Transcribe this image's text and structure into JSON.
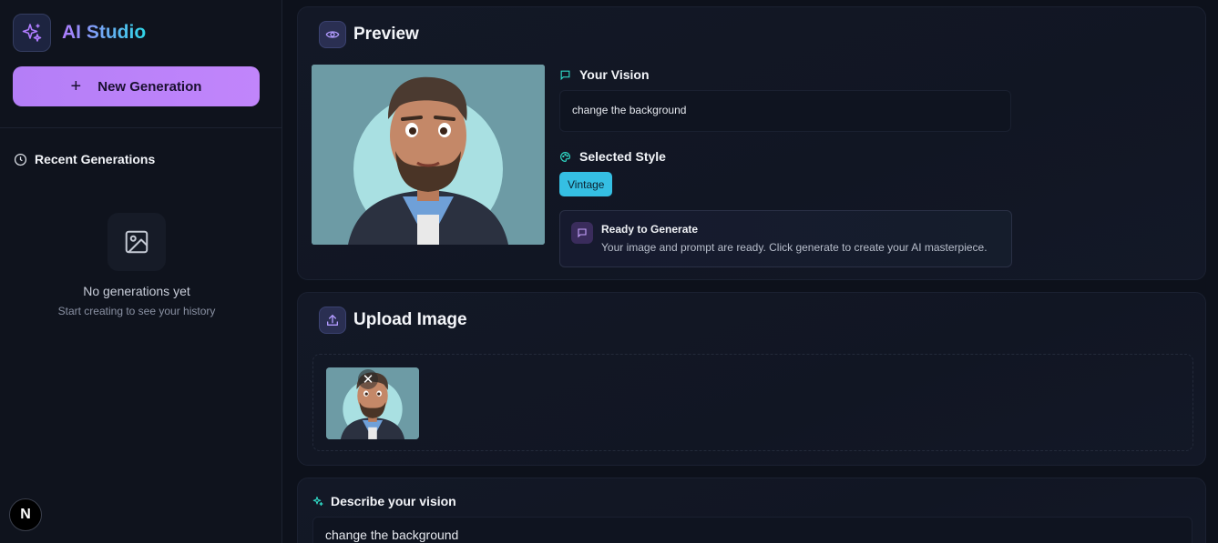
{
  "sidebar": {
    "brand_title": "AI Studio",
    "new_generation_label": "New Generation",
    "recent_title": "Recent Generations",
    "empty_title": "No generations yet",
    "empty_subtitle": "Start creating to see your history",
    "badge_letter": "N"
  },
  "preview": {
    "title": "Preview",
    "vision_label": "Your Vision",
    "vision_text": "change the background",
    "style_label": "Selected Style",
    "style_value": "Vintage",
    "ready_title": "Ready to Generate",
    "ready_text": "Your image and prompt are ready. Click generate to create your AI masterpiece."
  },
  "upload": {
    "title": "Upload Image",
    "remove_symbol": "✕"
  },
  "describe": {
    "title": "Describe your vision",
    "value": "change the background"
  },
  "colors": {
    "accent_purple": "#b47ef7",
    "accent_cyan": "#35bfe3",
    "background": "#0d111b"
  }
}
